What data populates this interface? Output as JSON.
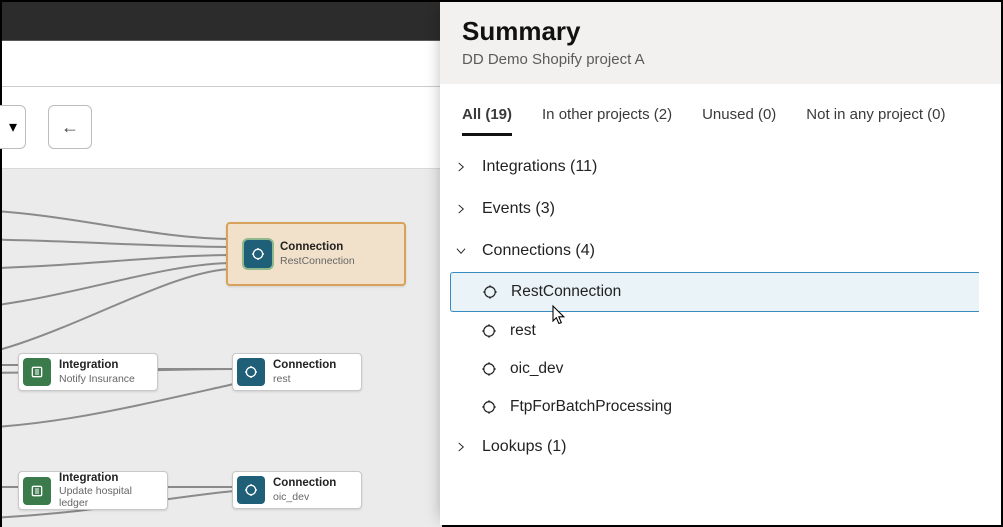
{
  "panel": {
    "title": "Summary",
    "subtitle": "DD Demo Shopify project A"
  },
  "tabs": [
    {
      "label": "All (19)",
      "active": true
    },
    {
      "label": "In other projects (2)",
      "active": false
    },
    {
      "label": "Unused (0)",
      "active": false
    },
    {
      "label": "Not in any project (0)",
      "active": false
    }
  ],
  "sections": [
    {
      "label": "Integrations (11)",
      "expanded": false
    },
    {
      "label": "Events (3)",
      "expanded": false
    },
    {
      "label": "Connections (4)",
      "expanded": true,
      "items": [
        {
          "label": "RestConnection",
          "selected": true
        },
        {
          "label": "rest"
        },
        {
          "label": "oic_dev"
        },
        {
          "label": "FtpForBatchProcessing"
        }
      ]
    },
    {
      "label": "Lookups (1)",
      "expanded": false
    }
  ],
  "canvas": {
    "nodes": {
      "highlighted_connection": {
        "title": "Connection",
        "sub": "RestConnection"
      },
      "integration1": {
        "title": "Integration",
        "sub": "Notify Insurance"
      },
      "connection_rest": {
        "title": "Connection",
        "sub": "rest"
      },
      "integration2": {
        "title": "Integration",
        "sub": "Update hospital ledger"
      },
      "connection_oic": {
        "title": "Connection",
        "sub": "oic_dev"
      }
    }
  }
}
